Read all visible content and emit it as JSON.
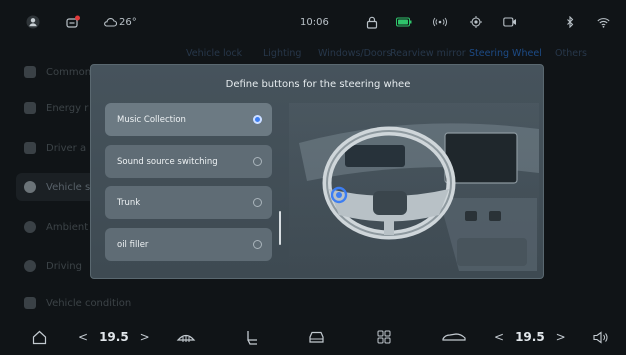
{
  "status_bar": {
    "weather_icon": "cloud-icon",
    "temperature": "26°",
    "time": "10:06",
    "icons": [
      "profile-icon",
      "notification-icon",
      "lock-icon",
      "battery-icon",
      "hotspot-icon",
      "location-icon",
      "camera-icon",
      "bluetooth-icon",
      "wifi-icon"
    ],
    "battery_color": "#2fc46b",
    "notification_badge_color": "#e13a3a"
  },
  "top_tabs": {
    "items": [
      "Vehicle lock",
      "Lighting",
      "Windows/Doors",
      "Rearview mirror",
      "Steering Wheel",
      "Others"
    ],
    "active": "Steering Wheel"
  },
  "sidebar": {
    "items": [
      "Common",
      "Energy r",
      "Driver a",
      "Vehicle s",
      "Ambient",
      "Driving",
      "Vehicle condition"
    ],
    "selected": "Vehicle s"
  },
  "modal": {
    "title": "Define buttons for the steering whee",
    "options": [
      {
        "label": "Music Collection",
        "selected": true
      },
      {
        "label": "Sound source switching",
        "selected": false
      },
      {
        "label": "Trunk",
        "selected": false
      },
      {
        "label": "oil filler",
        "selected": false
      }
    ],
    "accent_color": "#3d7ef2"
  },
  "dock": {
    "left_temp": "19.5",
    "right_temp": "19.5",
    "icons": [
      "home-icon",
      "rear-defrost-icon",
      "seat-icon",
      "car-front-icon",
      "apps-grid-icon",
      "car-side-icon",
      "volume-icon"
    ]
  }
}
